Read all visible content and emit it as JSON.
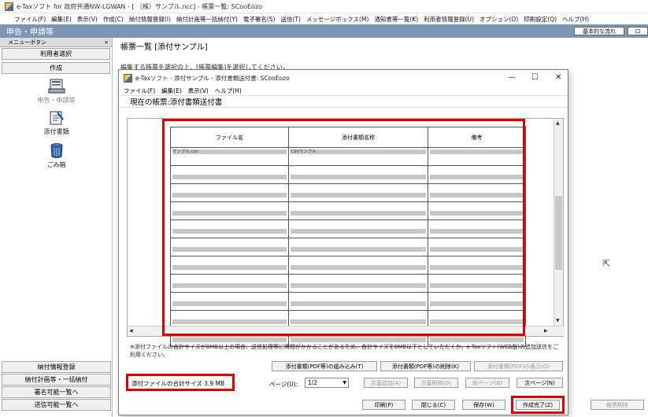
{
  "window": {
    "title": "e-Taxソフト  for  政府共通NW-LGWAN - [ （株）サンプル.ncc] - 帳票一覧: SCooEozo"
  },
  "menubar": [
    "ファイル(F)",
    "編集(E)",
    "表示(V)",
    "作成(C)",
    "納付情報登録(I)",
    "納付計画等一括納付(Y)",
    "電子署名(S)",
    "送信(T)",
    "メッセージボックス(M)",
    "通知書等一覧(K)",
    "利用者情報登録(U)",
    "オプション(O)",
    "印刷設定(Q)",
    "ヘルプ(H)"
  ],
  "band": {
    "title": "申告・申請等",
    "btn_basic": "基本的な流れ",
    "btn_ro": "ロ"
  },
  "sidebar": {
    "header": "メニューボタン",
    "close": "×",
    "user_select": "利用者選択",
    "create": "作成",
    "items": [
      {
        "label": "申告・申請等"
      },
      {
        "label": "添付書類"
      },
      {
        "label": "ごみ箱"
      }
    ],
    "bottom": [
      "納付情報登録",
      "納付計画等・一括納付",
      "署名可能一覧へ",
      "送信可能一覧へ"
    ]
  },
  "background": {
    "title": "帳票一覧 [添付サンプル]",
    "instruction": "編集する帳票を選択の上、[帳票編集]を選択してください。",
    "right_btn": "帳票削除"
  },
  "dialog": {
    "title": "e-Taxソフト - 添付サンプル - 添付書類送付書: SCooEozo",
    "min": "—",
    "max": "☐",
    "close": "✕",
    "menu": [
      "ファイル(F)",
      "編集(E)",
      "表示(V)",
      "ヘルプ(H)"
    ],
    "current_form": "現在の帳票:添付書類送付書",
    "table": {
      "headers": [
        "ファイル名",
        "添付書類名称",
        "備考"
      ],
      "first_row": [
        "サンプル.csv",
        "CSVサンプル",
        ""
      ],
      "empty_rows": 10
    },
    "note": "※添付ファイルの合計サイズが8MB以上の場合、送信処理等に時間がかかることがあるため、合計サイズを8MB以下としていただくか、e-Taxソフト(WEB版)の追加送信をご利用ください。",
    "buttons_row1": [
      {
        "label": "添付書類(PDF等)の組み込み(T)",
        "enabled": true
      },
      {
        "label": "添付書類(PDF等)の削除(K)",
        "enabled": true
      },
      {
        "label": "添付書類(PDF)の表示(O)",
        "enabled": false
      }
    ],
    "size_label": "添付ファイルの合計サイズ  3.9 MB",
    "page_label": "ページ(U):",
    "page_value": "1/2",
    "buttons_row2": [
      {
        "label": "次葉追加(A)",
        "enabled": false
      },
      {
        "label": "次葉削除(D)",
        "enabled": false
      },
      {
        "label": "前ページ(B)",
        "enabled": false
      },
      {
        "label": "次ページ(N)",
        "enabled": true
      }
    ],
    "buttons_row3": [
      {
        "label": "印刷(P)"
      },
      {
        "label": "閉じる(C)"
      },
      {
        "label": "保存(W)"
      },
      {
        "label": "作成完了(Z)"
      }
    ]
  },
  "highlight_color": "#e00000"
}
